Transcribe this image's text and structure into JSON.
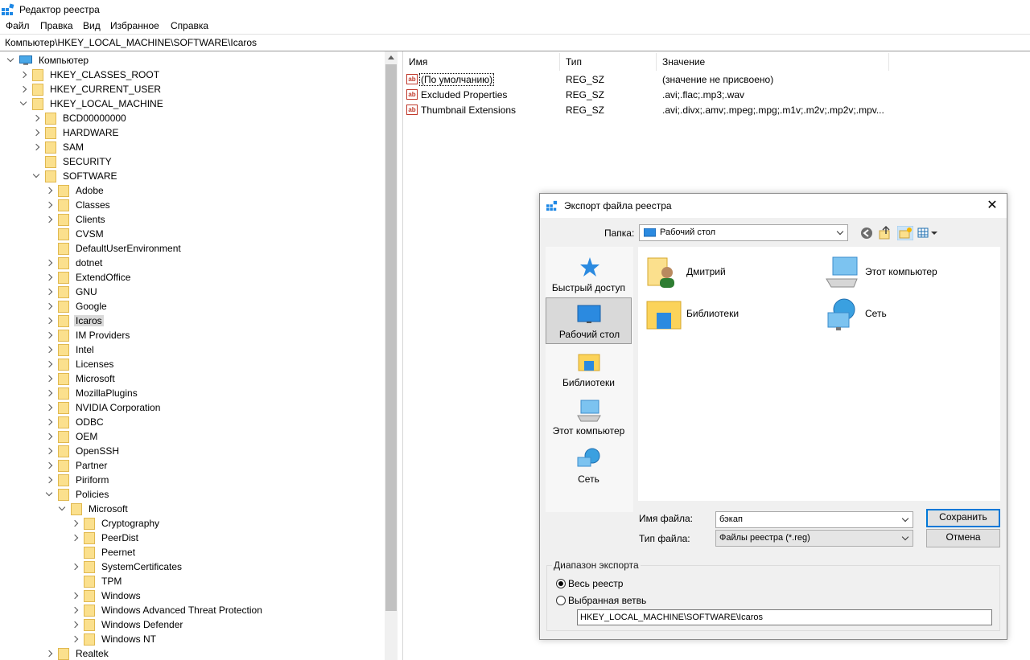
{
  "window": {
    "title": "Редактор реестра"
  },
  "menu": [
    {
      "label": "Файл"
    },
    {
      "label": "Правка"
    },
    {
      "label": "Вид"
    },
    {
      "label": "Избранное"
    },
    {
      "label": "Справка"
    }
  ],
  "address": "Компьютер\\HKEY_LOCAL_MACHINE\\SOFTWARE\\Icaros",
  "tree": [
    {
      "label": "Компьютер",
      "level": 0,
      "state": "down",
      "icon": "computer-icon"
    },
    {
      "label": "HKEY_CLASSES_ROOT",
      "level": 1,
      "state": "right"
    },
    {
      "label": "HKEY_CURRENT_USER",
      "level": 1,
      "state": "right"
    },
    {
      "label": "HKEY_LOCAL_MACHINE",
      "level": 1,
      "state": "down"
    },
    {
      "label": "BCD00000000",
      "level": 2,
      "state": "right"
    },
    {
      "label": "HARDWARE",
      "level": 2,
      "state": "right"
    },
    {
      "label": "SAM",
      "level": 2,
      "state": "right"
    },
    {
      "label": "SECURITY",
      "level": 2,
      "state": "none"
    },
    {
      "label": "SOFTWARE",
      "level": 2,
      "state": "down"
    },
    {
      "label": "Adobe",
      "level": 3,
      "state": "right"
    },
    {
      "label": "Classes",
      "level": 3,
      "state": "right"
    },
    {
      "label": "Clients",
      "level": 3,
      "state": "right"
    },
    {
      "label": "CVSM",
      "level": 3,
      "state": "none"
    },
    {
      "label": "DefaultUserEnvironment",
      "level": 3,
      "state": "none"
    },
    {
      "label": "dotnet",
      "level": 3,
      "state": "right"
    },
    {
      "label": "ExtendOffice",
      "level": 3,
      "state": "right"
    },
    {
      "label": "GNU",
      "level": 3,
      "state": "right"
    },
    {
      "label": "Google",
      "level": 3,
      "state": "right"
    },
    {
      "label": "Icaros",
      "level": 3,
      "state": "right",
      "selected": true
    },
    {
      "label": "IM Providers",
      "level": 3,
      "state": "right"
    },
    {
      "label": "Intel",
      "level": 3,
      "state": "right"
    },
    {
      "label": "Licenses",
      "level": 3,
      "state": "right"
    },
    {
      "label": "Microsoft",
      "level": 3,
      "state": "right"
    },
    {
      "label": "MozillaPlugins",
      "level": 3,
      "state": "right"
    },
    {
      "label": "NVIDIA Corporation",
      "level": 3,
      "state": "right"
    },
    {
      "label": "ODBC",
      "level": 3,
      "state": "right"
    },
    {
      "label": "OEM",
      "level": 3,
      "state": "right"
    },
    {
      "label": "OpenSSH",
      "level": 3,
      "state": "right"
    },
    {
      "label": "Partner",
      "level": 3,
      "state": "right"
    },
    {
      "label": "Piriform",
      "level": 3,
      "state": "right"
    },
    {
      "label": "Policies",
      "level": 3,
      "state": "down"
    },
    {
      "label": "Microsoft",
      "level": 4,
      "state": "down"
    },
    {
      "label": "Cryptography",
      "level": 5,
      "state": "right"
    },
    {
      "label": "PeerDist",
      "level": 5,
      "state": "right"
    },
    {
      "label": "Peernet",
      "level": 5,
      "state": "none"
    },
    {
      "label": "SystemCertificates",
      "level": 5,
      "state": "right"
    },
    {
      "label": "TPM",
      "level": 5,
      "state": "none"
    },
    {
      "label": "Windows",
      "level": 5,
      "state": "right"
    },
    {
      "label": "Windows Advanced Threat Protection",
      "level": 5,
      "state": "right"
    },
    {
      "label": "Windows Defender",
      "level": 5,
      "state": "right"
    },
    {
      "label": "Windows NT",
      "level": 5,
      "state": "right"
    },
    {
      "label": "Realtek",
      "level": 3,
      "state": "right"
    }
  ],
  "list": {
    "headers": {
      "name": "Имя",
      "type": "Тип",
      "value": "Значение"
    },
    "rows": [
      {
        "name": "(По умолчанию)",
        "type": "REG_SZ",
        "value": "(значение не присвоено)"
      },
      {
        "name": "Excluded Properties",
        "type": "REG_SZ",
        "value": ".avi;.flac;.mp3;.wav"
      },
      {
        "name": "Thumbnail Extensions",
        "type": "REG_SZ",
        "value": ".avi;.divx;.amv;.mpeg;.mpg;.m1v;.m2v;.mp2v;.mpv..."
      }
    ]
  },
  "dialog": {
    "title": "Экспорт файла реестра",
    "close": "✕",
    "folder_label": "Папка:",
    "folder_value": "Рабочий стол",
    "places": [
      {
        "label": "Быстрый доступ",
        "icon": "star-icon"
      },
      {
        "label": "Рабочий стол",
        "icon": "desktop-icon",
        "selected": true
      },
      {
        "label": "Библиотеки",
        "icon": "libraries-icon"
      },
      {
        "label": "Этот компьютер",
        "icon": "this-pc-icon"
      },
      {
        "label": "Сеть",
        "icon": "network-icon"
      }
    ],
    "items": [
      {
        "label": "Дмитрий",
        "icon": "user-folder-icon"
      },
      {
        "label": "Этот компьютер",
        "icon": "this-pc-icon"
      },
      {
        "label": "Библиотеки",
        "icon": "libraries-icon"
      },
      {
        "label": "Сеть",
        "icon": "network-icon"
      }
    ],
    "filename_label": "Имя файла:",
    "filename_value": "бэкап",
    "filetype_label": "Тип файла:",
    "filetype_value": "Файлы реестра (*.reg)",
    "save": "Сохранить",
    "cancel": "Отмена",
    "range_legend": "Диапазон экспорта",
    "range_all": "Весь реестр",
    "range_branch": "Выбранная ветвь",
    "branch_value": "HKEY_LOCAL_MACHINE\\SOFTWARE\\Icaros"
  }
}
